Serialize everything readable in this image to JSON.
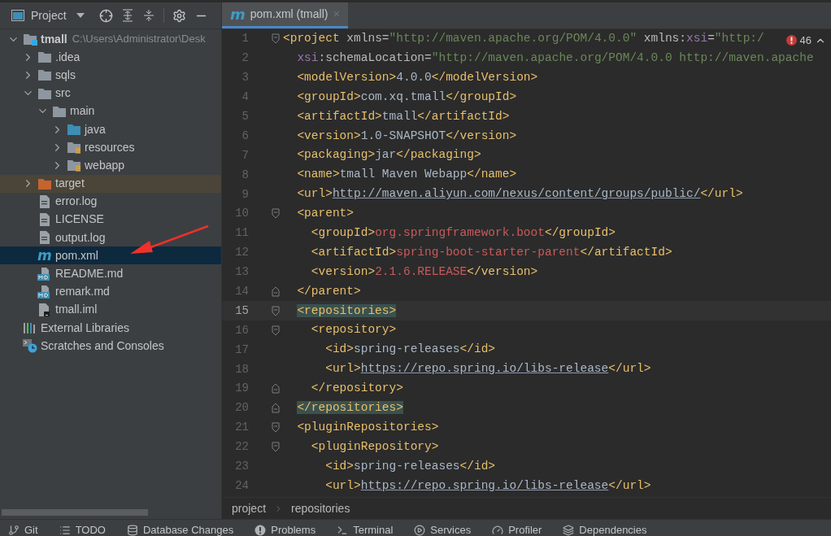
{
  "project_panel": {
    "title": "Project",
    "tree": [
      {
        "label": "tmall",
        "path": "C:\\Users\\Administrator\\Desk",
        "kind": "module",
        "expanded": true,
        "selected": false,
        "highlighted": false,
        "children": [
          {
            "label": ".idea",
            "kind": "folder",
            "expanded": false,
            "selected": false,
            "highlighted": false
          },
          {
            "label": "sqls",
            "kind": "folder",
            "expanded": false,
            "selected": false,
            "highlighted": false
          },
          {
            "label": "src",
            "kind": "folder",
            "expanded": true,
            "selected": false,
            "highlighted": false,
            "children": [
              {
                "label": "main",
                "kind": "folder",
                "expanded": true,
                "selected": false,
                "highlighted": false,
                "children": [
                  {
                    "label": "java",
                    "kind": "source-folder",
                    "expanded": false,
                    "selected": false,
                    "highlighted": false
                  },
                  {
                    "label": "resources",
                    "kind": "resource-folder",
                    "expanded": false,
                    "selected": false,
                    "highlighted": false
                  },
                  {
                    "label": "webapp",
                    "kind": "resource-folder",
                    "expanded": false,
                    "selected": false,
                    "highlighted": false
                  }
                ]
              }
            ]
          },
          {
            "label": "target",
            "kind": "excluded-folder",
            "expanded": false,
            "selected": false,
            "highlighted": true
          },
          {
            "label": "error.log",
            "kind": "text-file",
            "selected": false,
            "highlighted": false
          },
          {
            "label": "LICENSE",
            "kind": "text-file",
            "selected": false,
            "highlighted": false
          },
          {
            "label": "output.log",
            "kind": "text-file",
            "selected": false,
            "highlighted": false
          },
          {
            "label": "pom.xml",
            "kind": "maven-file",
            "glyph": "m",
            "selected": true,
            "highlighted": false
          },
          {
            "label": "README.md",
            "kind": "markdown-file",
            "selected": false,
            "highlighted": false
          },
          {
            "label": "remark.md",
            "kind": "markdown-file",
            "selected": false,
            "highlighted": false
          },
          {
            "label": "tmall.iml",
            "kind": "iml-file",
            "selected": false,
            "highlighted": false
          }
        ]
      },
      {
        "label": "External Libraries",
        "kind": "libraries",
        "selected": false,
        "highlighted": false
      },
      {
        "label": "Scratches and Consoles",
        "kind": "scratches",
        "selected": false,
        "highlighted": false
      }
    ]
  },
  "editor": {
    "tabs": [
      {
        "label": "pom.xml (tmall)",
        "glyph": "m",
        "selected": true,
        "close": "×"
      }
    ],
    "problems": {
      "count": "46"
    },
    "lines": [
      {
        "number": "1",
        "current": false,
        "kind": "fold-start",
        "tokens": [
          {
            "kind": "tag",
            "text": "<project"
          },
          {
            "kind": "attr",
            "text": " xmlns="
          },
          {
            "kind": "string",
            "text": "\"http://maven.apache.org/POM/4.0.0\""
          },
          {
            "kind": "attr",
            "text": " xmlns:"
          },
          {
            "kind": "ns",
            "text": "xsi"
          },
          {
            "kind": "attr",
            "text": "="
          },
          {
            "kind": "string",
            "text": "\"http:/"
          }
        ]
      },
      {
        "number": "2",
        "current": false,
        "kind": "plain",
        "tokens": [
          {
            "kind": "ns",
            "text": "  xsi"
          },
          {
            "kind": "attr",
            "text": ":schemaLocation="
          },
          {
            "kind": "string",
            "text": "\"http://maven.apache.org/POM/4.0.0 http://maven.apache"
          }
        ]
      },
      {
        "number": "3",
        "current": false,
        "kind": "plain",
        "tokens": [
          {
            "kind": "tag",
            "text": "  <modelVersion>"
          },
          {
            "kind": "text",
            "text": "4.0.0"
          },
          {
            "kind": "tag",
            "text": "</modelVersion>"
          }
        ]
      },
      {
        "number": "4",
        "current": false,
        "kind": "plain",
        "tokens": [
          {
            "kind": "tag",
            "text": "  <groupId>"
          },
          {
            "kind": "text",
            "text": "com.xq.tmall"
          },
          {
            "kind": "tag",
            "text": "</groupId>"
          }
        ]
      },
      {
        "number": "5",
        "current": false,
        "kind": "plain",
        "tokens": [
          {
            "kind": "tag",
            "text": "  <artifactId>"
          },
          {
            "kind": "text",
            "text": "tmall"
          },
          {
            "kind": "tag",
            "text": "</artifactId>"
          }
        ]
      },
      {
        "number": "6",
        "current": false,
        "kind": "plain",
        "tokens": [
          {
            "kind": "tag",
            "text": "  <version>"
          },
          {
            "kind": "text",
            "text": "1.0-SNAPSHOT"
          },
          {
            "kind": "tag",
            "text": "</version>"
          }
        ]
      },
      {
        "number": "7",
        "current": false,
        "kind": "plain",
        "tokens": [
          {
            "kind": "tag",
            "text": "  <packaging>"
          },
          {
            "kind": "text",
            "text": "jar"
          },
          {
            "kind": "tag",
            "text": "</packaging>"
          }
        ]
      },
      {
        "number": "8",
        "current": false,
        "kind": "plain",
        "tokens": [
          {
            "kind": "tag",
            "text": "  <name>"
          },
          {
            "kind": "text",
            "text": "tmall Maven Webapp"
          },
          {
            "kind": "tag",
            "text": "</name>"
          }
        ]
      },
      {
        "number": "9",
        "current": false,
        "kind": "plain",
        "tokens": [
          {
            "kind": "tag",
            "text": "  <url>"
          },
          {
            "kind": "link",
            "text": "http://maven.aliyun.com/nexus/content/groups/public/"
          },
          {
            "kind": "tag",
            "text": "</url>"
          }
        ]
      },
      {
        "number": "10",
        "current": false,
        "kind": "fold-start",
        "tokens": [
          {
            "kind": "tag",
            "text": "  <parent>"
          }
        ]
      },
      {
        "number": "11",
        "current": false,
        "kind": "plain",
        "tokens": [
          {
            "kind": "tag",
            "text": "    <groupId>"
          },
          {
            "kind": "value",
            "text": "org.springframework.boot"
          },
          {
            "kind": "tag",
            "text": "</groupId>"
          }
        ]
      },
      {
        "number": "12",
        "current": false,
        "kind": "plain",
        "tokens": [
          {
            "kind": "tag",
            "text": "    <artifactId>"
          },
          {
            "kind": "value",
            "text": "spring-boot-starter-parent"
          },
          {
            "kind": "tag",
            "text": "</artifactId>"
          }
        ]
      },
      {
        "number": "13",
        "current": false,
        "kind": "plain",
        "tokens": [
          {
            "kind": "tag",
            "text": "    <version>"
          },
          {
            "kind": "value",
            "text": "2.1.6.RELEASE"
          },
          {
            "kind": "tag",
            "text": "</version>"
          }
        ]
      },
      {
        "number": "14",
        "current": false,
        "kind": "fold-end",
        "tokens": [
          {
            "kind": "tag",
            "text": "  </parent>"
          }
        ]
      },
      {
        "number": "15",
        "current": true,
        "kind": "fold-start",
        "tokens": [
          {
            "kind": "match",
            "text": "  <repositories>"
          }
        ]
      },
      {
        "number": "16",
        "current": false,
        "kind": "fold-start",
        "tokens": [
          {
            "kind": "tag",
            "text": "    <repository>"
          }
        ]
      },
      {
        "number": "17",
        "current": false,
        "kind": "plain",
        "tokens": [
          {
            "kind": "tag",
            "text": "      <id>"
          },
          {
            "kind": "text",
            "text": "spring-releases"
          },
          {
            "kind": "tag",
            "text": "</id>"
          }
        ]
      },
      {
        "number": "18",
        "current": false,
        "kind": "plain",
        "tokens": [
          {
            "kind": "tag",
            "text": "      <url>"
          },
          {
            "kind": "link",
            "text": "https://repo.spring.io/libs-release"
          },
          {
            "kind": "tag",
            "text": "</url>"
          }
        ]
      },
      {
        "number": "19",
        "current": false,
        "kind": "fold-end",
        "tokens": [
          {
            "kind": "tag",
            "text": "    </repository>"
          }
        ]
      },
      {
        "number": "20",
        "current": false,
        "kind": "fold-end",
        "tokens": [
          {
            "kind": "match",
            "text": "  </repositories>"
          }
        ]
      },
      {
        "number": "21",
        "current": false,
        "kind": "fold-start",
        "tokens": [
          {
            "kind": "tag",
            "text": "  <pluginRepositories>"
          }
        ]
      },
      {
        "number": "22",
        "current": false,
        "kind": "fold-start",
        "tokens": [
          {
            "kind": "tag",
            "text": "    <pluginRepository>"
          }
        ]
      },
      {
        "number": "23",
        "current": false,
        "kind": "plain",
        "tokens": [
          {
            "kind": "tag",
            "text": "      <id>"
          },
          {
            "kind": "text",
            "text": "spring-releases"
          },
          {
            "kind": "tag",
            "text": "</id>"
          }
        ]
      },
      {
        "number": "24",
        "current": false,
        "kind": "plain",
        "tokens": [
          {
            "kind": "tag",
            "text": "      <url>"
          },
          {
            "kind": "link",
            "text": "https://repo.spring.io/libs-release"
          },
          {
            "kind": "tag",
            "text": "</url>"
          }
        ]
      }
    ],
    "breadcrumbs": [
      "project",
      "repositories"
    ]
  },
  "tool_windows": [
    {
      "label": "Git",
      "kind": "git"
    },
    {
      "label": "TODO",
      "kind": "todo"
    },
    {
      "label": "Database Changes",
      "kind": "database"
    },
    {
      "label": "Problems",
      "kind": "problems"
    },
    {
      "label": "Terminal",
      "kind": "terminal"
    },
    {
      "label": "Services",
      "kind": "services"
    },
    {
      "label": "Profiler",
      "kind": "profiler"
    },
    {
      "label": "Dependencies",
      "kind": "dependencies"
    }
  ]
}
